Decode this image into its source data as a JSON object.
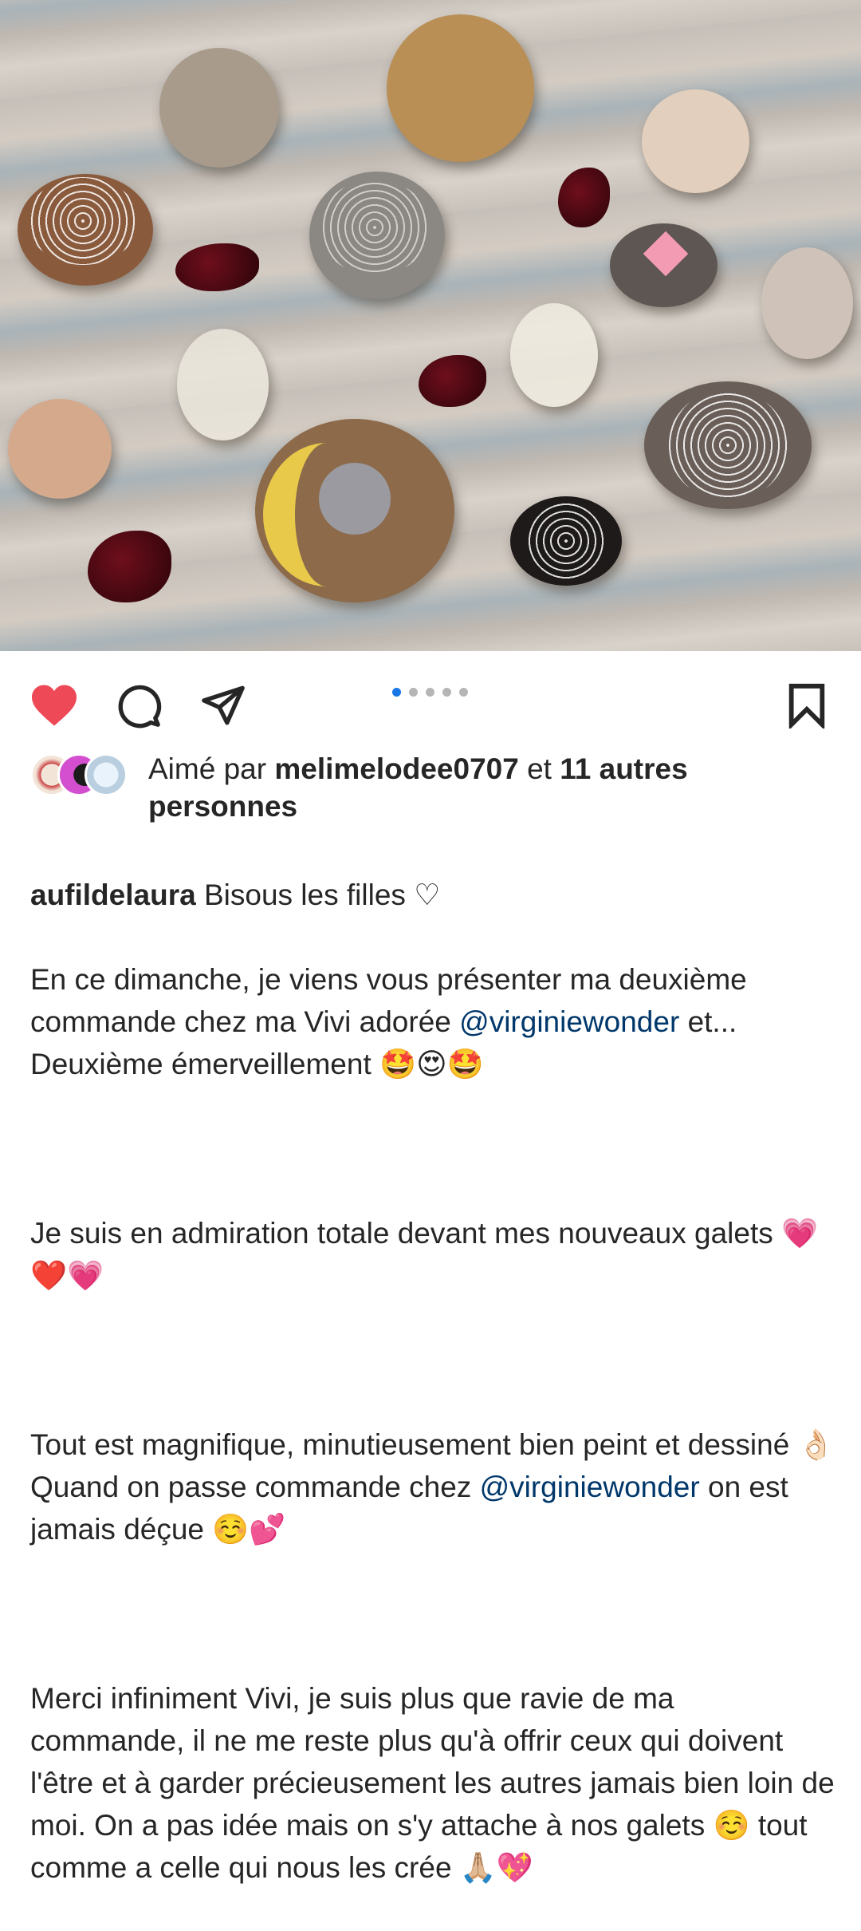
{
  "post": {
    "image_alt": "painted pebbles",
    "carousel": {
      "count": 5,
      "active_index": 0
    },
    "liked": true
  },
  "likes": {
    "prefix": "Aimé par ",
    "user": "melimelodee0707",
    "middle": " et ",
    "others": "11 autres personnes"
  },
  "caption": {
    "username": "aufildelaura",
    "first_line": " Bisous les filles ♡",
    "p1_a": "En ce dimanche, je viens vous présenter ma deuxième commande chez ma Vivi adorée ",
    "p1_mention": "@virginiewonder",
    "p1_b": " et... Deuxième émerveillement 🤩😍🤩",
    "p2": "Je suis en admiration totale devant mes nouveaux galets 💗❤️💗",
    "p3_a": "Tout est magnifique, minutieusement bien peint et dessiné 👌🏻 Quand on passe commande chez ",
    "p3_mention": "@virginiewonder",
    "p3_b": " on est jamais déçue ☺️💕",
    "p4": "Merci infiniment Vivi, je suis plus que ravie de ma commande, il ne me reste plus qu'à offrir ceux qui doivent l'être et à garder précieusement les autres jamais bien loin de moi. On a pas idée mais on s'y attache à nos galets ☺️ tout comme a celle qui nous les crée 🙏🏼💖"
  },
  "colors": {
    "heart": "#ed4956",
    "active_dot": "#1877e5",
    "mention": "#00376b"
  }
}
